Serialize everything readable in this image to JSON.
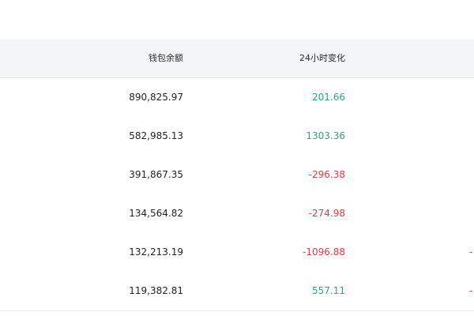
{
  "colors": {
    "positive": "#2ea37f",
    "negative": "#e0383e",
    "header_bg": "#f4f5f8"
  },
  "table": {
    "headers": {
      "balance": "钱包余额",
      "change_24h": "24小时变化"
    },
    "rows": [
      {
        "balance": "890,825.97",
        "change": "201.66",
        "direction": "positive",
        "edge": ""
      },
      {
        "balance": "582,985.13",
        "change": "1303.36",
        "direction": "positive",
        "edge": ""
      },
      {
        "balance": "391,867.35",
        "change": "-296.38",
        "direction": "negative",
        "edge": ""
      },
      {
        "balance": "134,564.82",
        "change": "-274.98",
        "direction": "negative",
        "edge": ""
      },
      {
        "balance": "132,213.19",
        "change": "-1096.88",
        "direction": "negative",
        "edge": "-"
      },
      {
        "balance": "119,382.81",
        "change": "557.11",
        "direction": "positive",
        "edge": "-"
      }
    ]
  }
}
